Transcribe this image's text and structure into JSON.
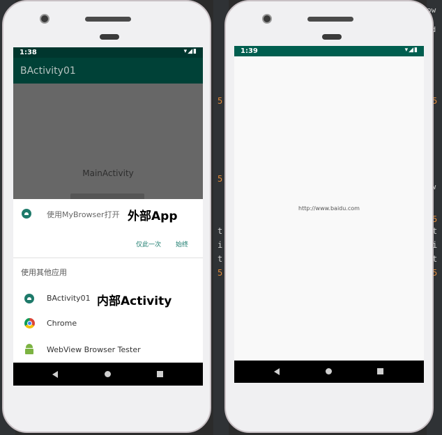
{
  "ide": {
    "left_glyphs": [
      "5",
      "5",
      "t",
      "i",
      "t",
      "5"
    ],
    "right_glyphs": [
      "ow",
      "ad",
      "ow",
      "5",
      "5",
      "t",
      "i",
      "t",
      "5"
    ]
  },
  "left_phone": {
    "status": {
      "time": "1:38",
      "icons": "▾◢▮"
    },
    "appbar_title": "BActivity01",
    "content_label": "MainActivity",
    "chooser": {
      "primary_label": "使用MyBrowser打开",
      "primary_annotation": "外部App",
      "just_once_label": "仅此一次",
      "always_label": "始终",
      "section_title": "使用其他应用",
      "apps": [
        {
          "label": "BActivity01",
          "annotation": "内部Activity",
          "icon": "android-app-icon"
        },
        {
          "label": "Chrome",
          "annotation": "",
          "icon": "chrome-icon"
        },
        {
          "label": "WebView Browser Tester",
          "annotation": "",
          "icon": "android-bot-icon"
        }
      ]
    }
  },
  "right_phone": {
    "status": {
      "time": "1:39",
      "icons": "▾◢▮"
    },
    "url_text": "http://www.baidu.com"
  },
  "colors": {
    "status_bar": "#00362e",
    "app_bar": "#004137",
    "accent": "#1f7e70",
    "dim_overlay": "#676767",
    "right_status_bar": "#005e4f"
  }
}
